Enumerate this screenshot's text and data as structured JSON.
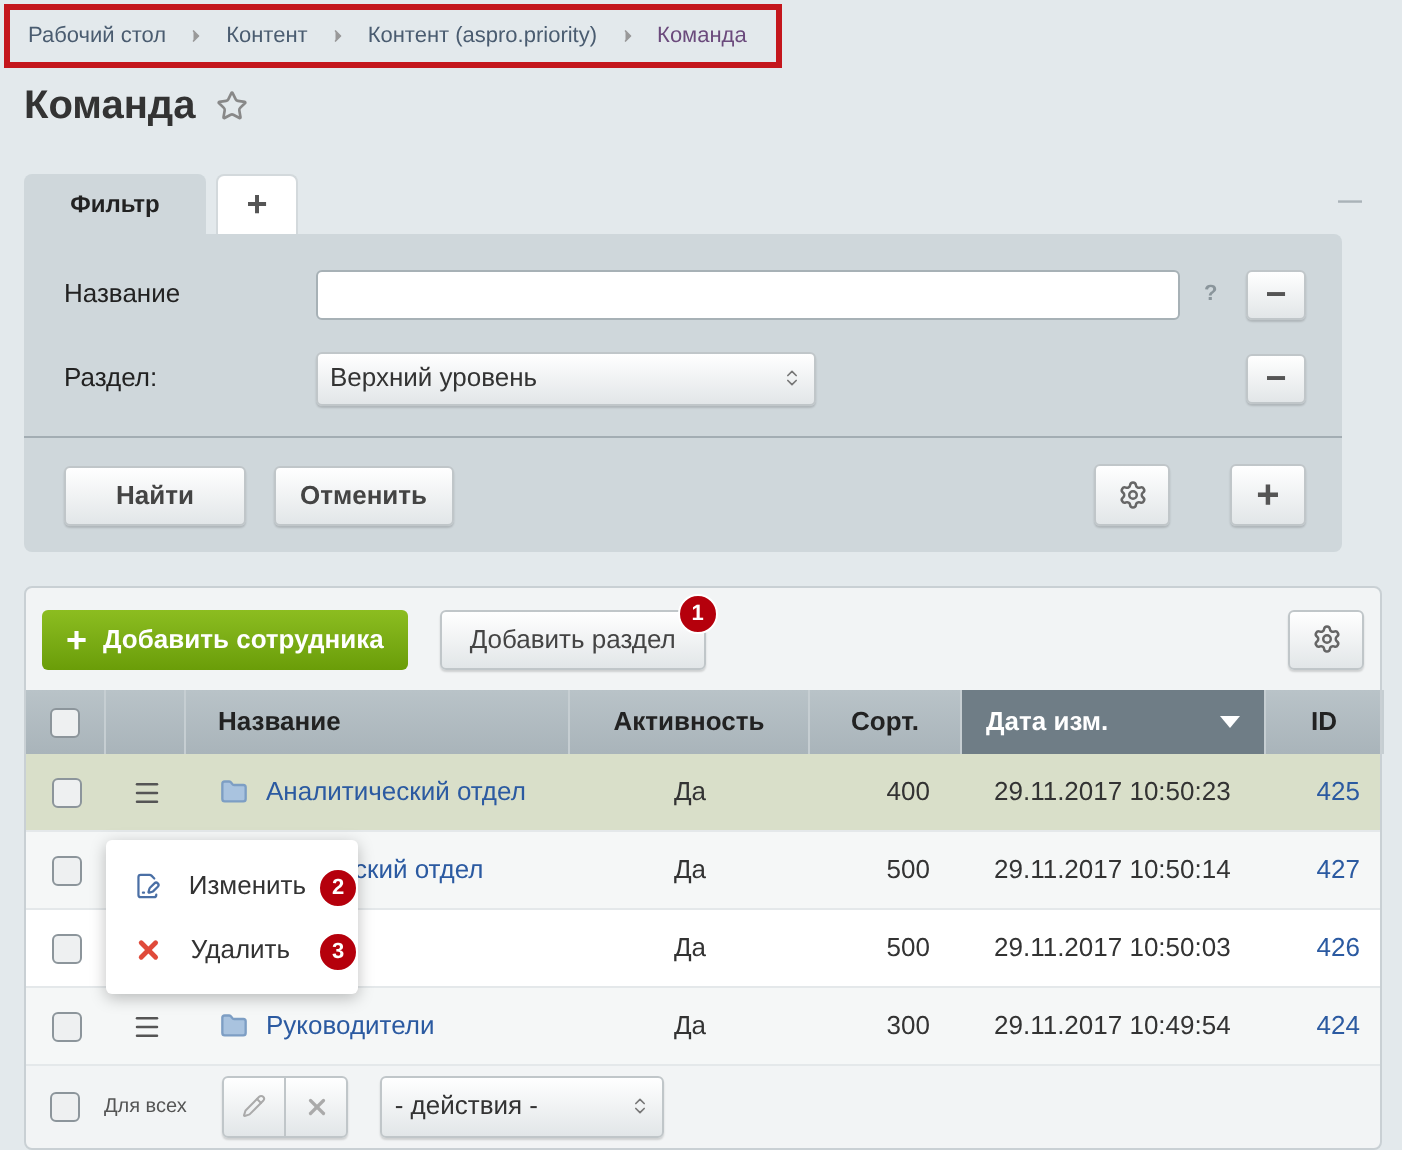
{
  "breadcrumbs": [
    {
      "label": "Рабочий стол"
    },
    {
      "label": "Контент"
    },
    {
      "label": "Контент (aspro.priority)"
    },
    {
      "label": "Команда"
    }
  ],
  "page_title": "Команда",
  "favorite": false,
  "filter": {
    "tabs": [
      {
        "label": "Фильтр",
        "kind": "text",
        "selected": true
      },
      {
        "label": "+",
        "kind": "add",
        "selected": false
      }
    ],
    "collapse_label": "—",
    "fields": [
      {
        "label": "Название",
        "kind": "input",
        "help": "?",
        "remove": "−"
      },
      {
        "label": "Раздел:",
        "kind": "select",
        "value": "Верхний уровень",
        "remove": "−"
      }
    ],
    "buttons": [
      "Найти",
      "Отменить"
    ],
    "add_label": "+"
  },
  "toolbar": {
    "add_button": "Добавить сотрудника",
    "add_icon": "+",
    "section_button": "Добавить раздел",
    "section_callout": "1"
  },
  "table": {
    "columns": [
      {
        "kind": "check",
        "sorted": false
      },
      {
        "kind": "menu",
        "sorted": false
      },
      {
        "label": "Название",
        "kind": "name",
        "sorted": false
      },
      {
        "label": "Активность",
        "kind": "center",
        "sorted": false
      },
      {
        "label": "Сорт.",
        "kind": "center",
        "sorted": false
      },
      {
        "label": "Дата изм.",
        "kind": "date",
        "sorted": true
      },
      {
        "label": "ID",
        "kind": "center",
        "sorted": false
      }
    ],
    "rows": [
      {
        "checked": false,
        "selected": true,
        "actions_icon": true,
        "folder": true,
        "name": "Аналитический отдел",
        "active": "Да",
        "sort": "400",
        "date": "29.11.2017 10:50:23",
        "id": "425"
      },
      {
        "checked": false,
        "selected": false,
        "name": "ский отдел",
        "active": "Да",
        "sort": "500",
        "date": "29.11.2017 10:50:14",
        "id": "427"
      },
      {
        "checked": false,
        "selected": false,
        "active": "Да",
        "sort": "500",
        "date": "29.11.2017 10:50:03",
        "id": "426"
      },
      {
        "checked": false,
        "selected": false,
        "actions_icon": true,
        "folder": true,
        "name": "Руководители",
        "active": "Да",
        "sort": "300",
        "date": "29.11.2017 10:49:54",
        "id": "424"
      }
    ]
  },
  "context_menu": [
    {
      "label": "Изменить",
      "kind": "edit",
      "callout": "2"
    },
    {
      "label": "Удалить",
      "kind": "delete",
      "callout": "3"
    }
  ],
  "footer": {
    "all_checked": false,
    "all_label": "Для всех",
    "actions_select": "- действия -"
  }
}
